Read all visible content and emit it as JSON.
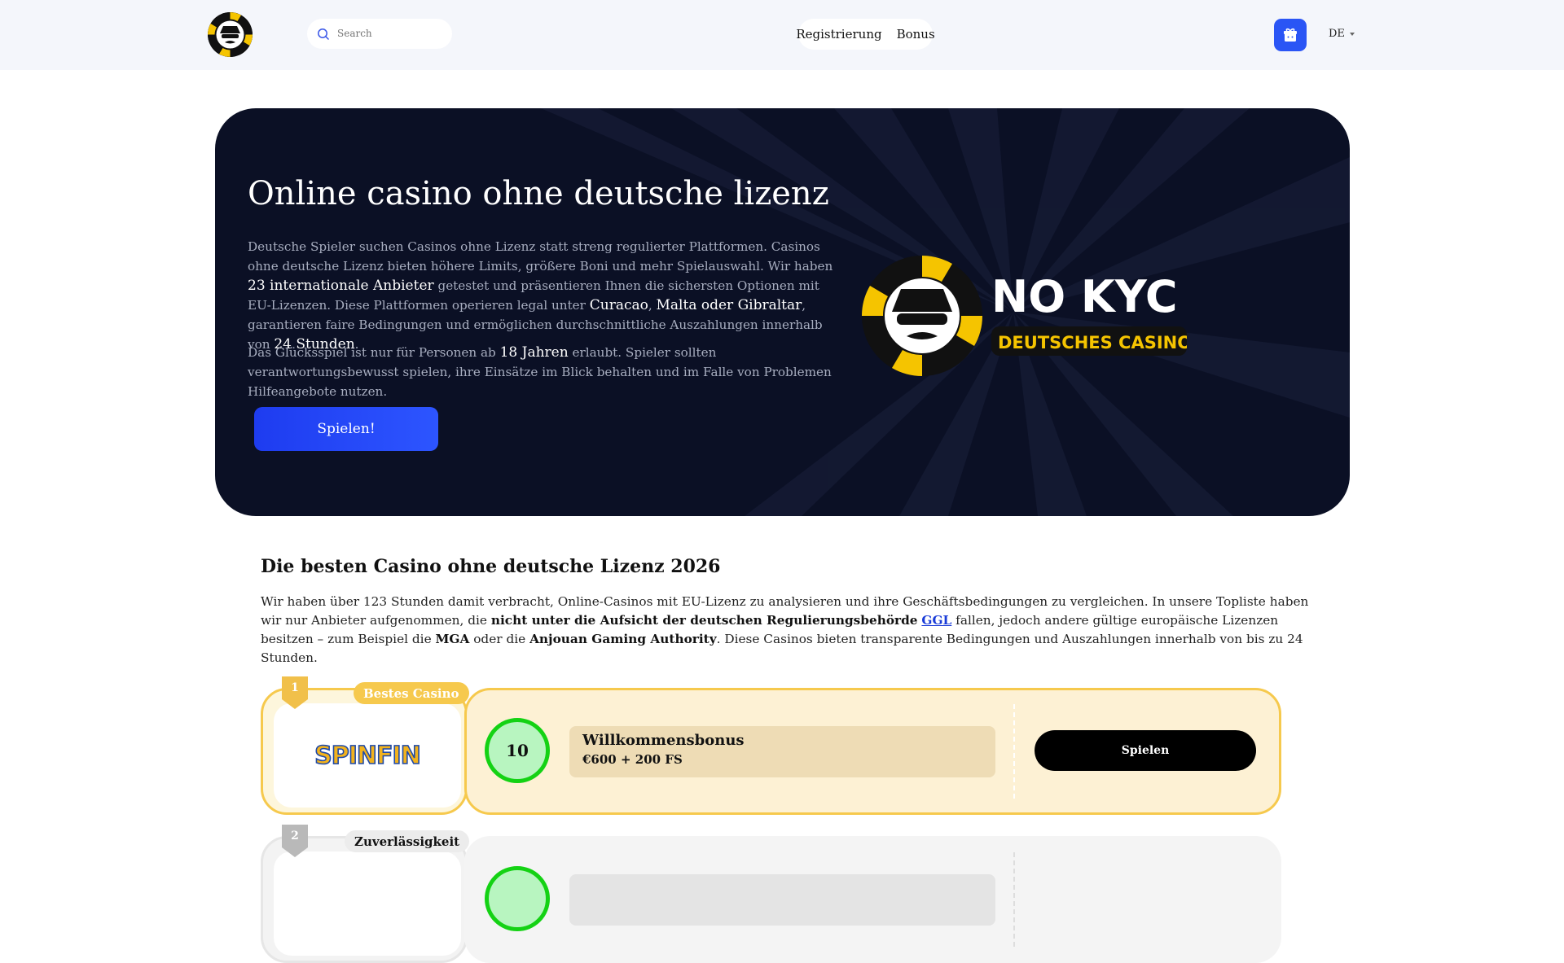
{
  "header": {
    "search_placeholder": "Search",
    "nav": [
      "Registrierung",
      "Bonus"
    ],
    "language": "DE"
  },
  "hero": {
    "title": "Online casino ohne deutsche lizenz",
    "p1": [
      "Deutsche Spieler suchen Casinos ohne Lizenz statt streng regulierter Plattformen. Casinos ohne deutsche Lizenz bieten höhere Limits, größere Boni und mehr Spielauswahl. Wir haben ",
      "23 internationale Anbieter",
      " getestet und präsentieren Ihnen die sichersten Optionen mit EU-Lizenzen. Diese Plattformen operieren legal unter ",
      "Curacao",
      ", ",
      "Malta oder Gibraltar",
      ", garantieren faire Bedingungen und ermöglichen durchschnittliche Auszahlungen innerhalb von ",
      "24 Stunden",
      "."
    ],
    "p2": [
      "Das Glücksspiel ist nur für Personen ab ",
      "18 Jahren",
      " erlaubt. Spieler sollten verantwortungsbewusst spielen, ihre Einsätze im Blick behalten und im Falle von Problemen Hilfeangebote nutzen."
    ],
    "button": "Spielen!",
    "brand_line1": "NO KYC",
    "brand_line2": "DEUTSCHES CASINO"
  },
  "section": {
    "title": "Die besten Casino ohne deutsche Lizenz 2026",
    "t1": "Wir haben über 123 Stunden damit verbracht, Online-Casinos mit EU-Lizenz zu analysieren und ihre Geschäftsbedingungen zu vergleichen. In unsere Topliste haben wir nur Anbieter aufgenommen, die ",
    "b1": "nicht unter die Aufsicht der deutschen Regulierungsbehörde",
    "link": "GGL",
    "t2": " fallen, jedoch andere gültige europäische Lizenzen besitzen – zum Beispiel die ",
    "b2": "MGA",
    "t3": " oder die ",
    "b3": "Anjouan Gaming Authority",
    "t4": ". Diese Casinos bieten transparente Bedingungen und Auszahlungen innerhalb von bis zu 24 Stunden."
  },
  "casinos": [
    {
      "rank": "1",
      "tag": "Bestes Casino",
      "logo_text": "SPINFIN",
      "score": "10",
      "bonus_title": "Willkommensbonus",
      "bonus_value": "€600 + 200 FS",
      "cta": "Spielen"
    },
    {
      "rank": "2",
      "tag": "Zuverlässigkeit"
    }
  ],
  "colors": {
    "accent": "#2a55f5",
    "hero_bg": "#0b1025",
    "gold": "#f6c94d",
    "score_green": "#14d214"
  }
}
